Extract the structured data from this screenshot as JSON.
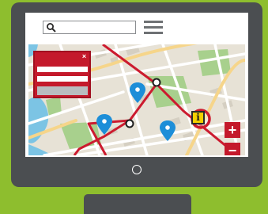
{
  "search": {
    "value": "",
    "placeholder": "",
    "icon": "search-icon"
  },
  "menu": {
    "icon": "hamburger-menu-icon"
  },
  "panel": {
    "close_glyph": "×",
    "field_1_value": "",
    "field_2_value": "",
    "submit_label": ""
  },
  "zoom": {
    "in_label": "+",
    "out_label": "−"
  },
  "info": {
    "glyph": "i"
  },
  "colors": {
    "background": "#8ebe2e",
    "bezel": "#4b4e51",
    "accent_red": "#c4192b",
    "route": "#cc1b2f",
    "pin_blue": "#1d8ed8",
    "park_green": "#a8d08d",
    "water": "#7cc4e4",
    "road_yellow": "#f6d58a",
    "map_base": "#e7e2d6",
    "info_yellow": "#f4d000"
  }
}
